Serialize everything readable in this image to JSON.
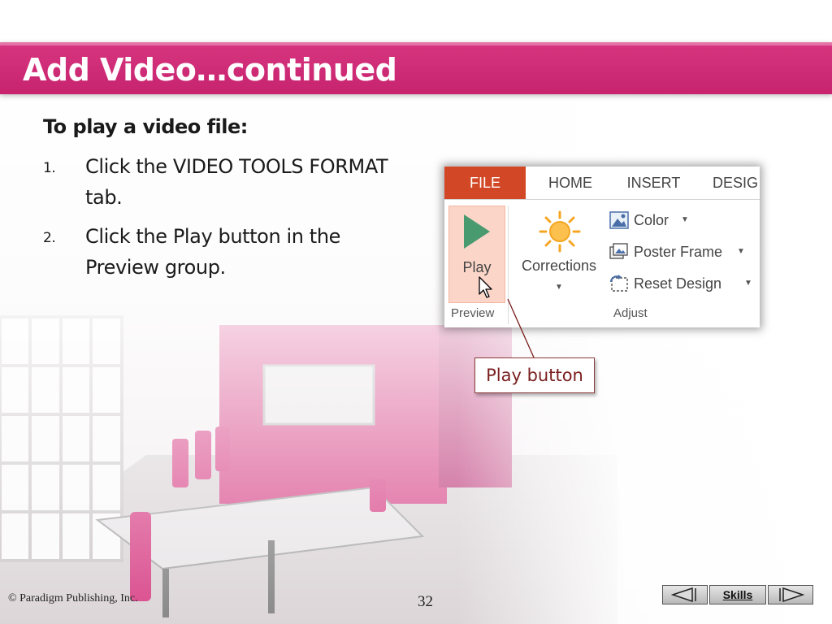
{
  "slide": {
    "title": "Add Video…continued",
    "subheading": "To play a video file:",
    "steps": [
      {
        "num": "1.",
        "text": "Click the VIDEO TOOLS FORMAT tab."
      },
      {
        "num": "2.",
        "text": "Click the Play button in the Preview group."
      }
    ]
  },
  "ribbon": {
    "tabs": [
      "FILE",
      "HOME",
      "INSERT",
      "DESIG"
    ],
    "play_label": "Play",
    "corrections_label": "Corrections",
    "color_label": "Color",
    "poster_frame_label": "Poster Frame",
    "reset_design_label": "Reset Design",
    "preview_group": "Preview",
    "adjust_group": "Adjust"
  },
  "callout": "Play button",
  "footer": {
    "copyright": "© Paradigm Publishing, Inc.",
    "page_number": "32",
    "skills_label": "Skills"
  },
  "colors": {
    "banner": "#cc2b75",
    "file_tab": "#d24726",
    "play_highlight": "#fbd5c8",
    "play_icon": "#4a9a6f"
  },
  "icons": [
    "play-icon",
    "sun-icon",
    "color-icon",
    "poster-frame-icon",
    "reset-design-icon",
    "cursor-icon",
    "arrow-left-icon",
    "arrow-right-icon"
  ]
}
